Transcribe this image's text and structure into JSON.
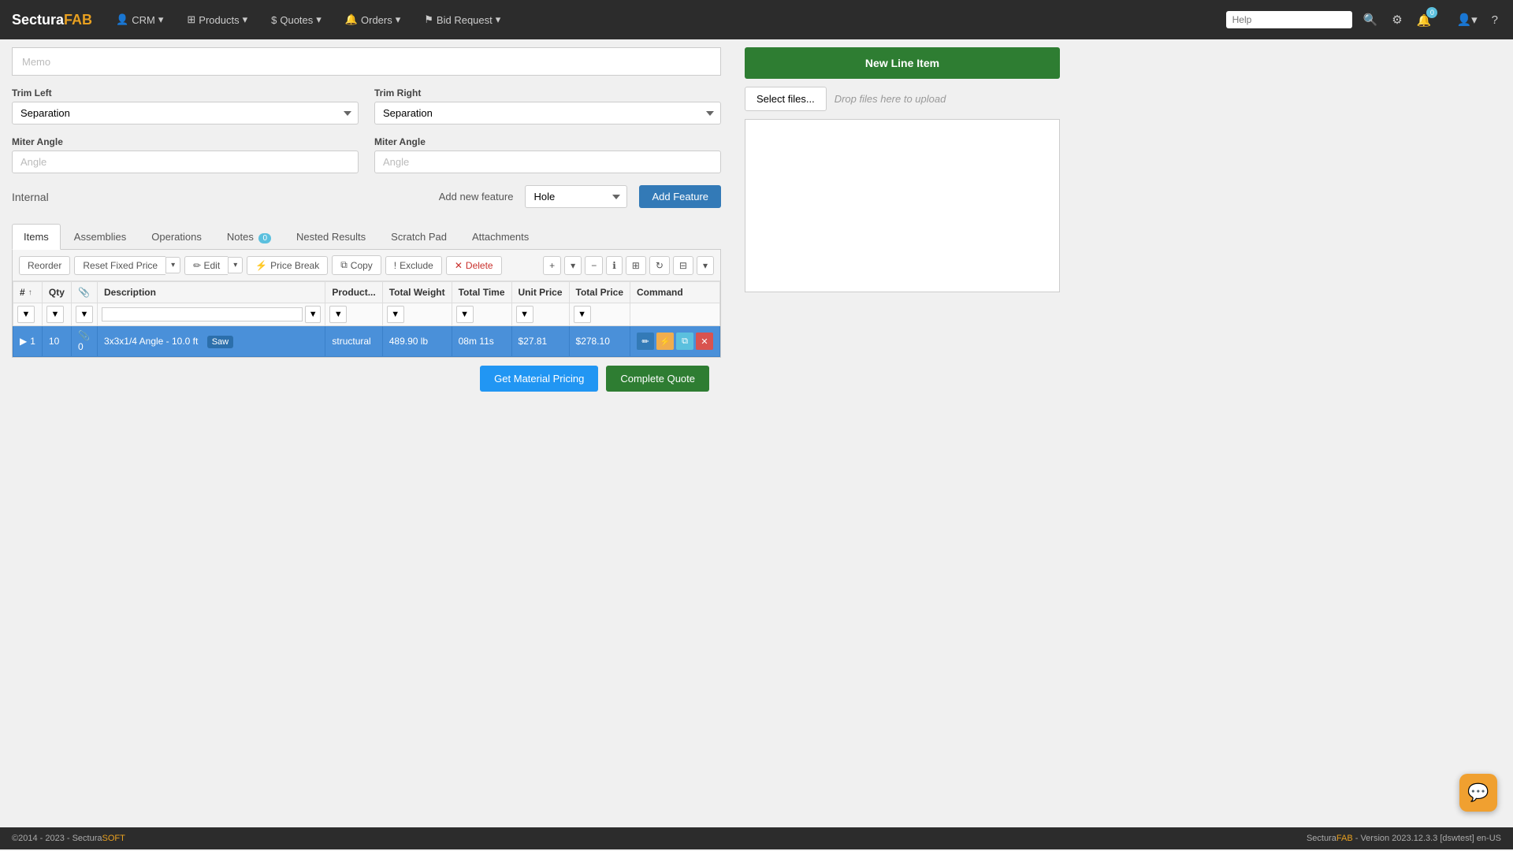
{
  "navbar": {
    "brand": "Sectura",
    "brand_highlight": "FAB",
    "nav_items": [
      {
        "label": "CRM",
        "icon": "user-icon"
      },
      {
        "label": "Products",
        "icon": "grid-icon"
      },
      {
        "label": "Quotes",
        "icon": "dollar-icon"
      },
      {
        "label": "Orders",
        "icon": "bell-icon"
      },
      {
        "label": "Bid Request",
        "icon": "flag-icon"
      }
    ],
    "search_placeholder": "Help",
    "badge_count": "0"
  },
  "header": {
    "new_line_item": "New Line Item"
  },
  "form": {
    "memo_placeholder": "Memo",
    "trim_left_label": "Trim Left",
    "trim_left_value": "Separation",
    "trim_right_label": "Trim Right",
    "trim_right_value": "Separation",
    "miter_left_label": "Miter Angle",
    "miter_left_placeholder": "Angle",
    "miter_right_label": "Miter Angle",
    "miter_right_placeholder": "Angle",
    "internal_label": "Internal",
    "add_new_feature_label": "Add new feature",
    "feature_value": "Hole",
    "add_feature_btn": "Add Feature"
  },
  "tabs": [
    {
      "label": "Items",
      "badge": null,
      "active": true
    },
    {
      "label": "Assemblies",
      "badge": null,
      "active": false
    },
    {
      "label": "Operations",
      "badge": null,
      "active": false
    },
    {
      "label": "Notes",
      "badge": "0",
      "active": false
    },
    {
      "label": "Nested Results",
      "badge": null,
      "active": false
    },
    {
      "label": "Scratch Pad",
      "badge": null,
      "active": false
    },
    {
      "label": "Attachments",
      "badge": null,
      "active": false
    }
  ],
  "toolbar": {
    "reorder": "Reorder",
    "reset_fixed_price": "Reset Fixed Price",
    "edit": "Edit",
    "price_break": "Price Break",
    "copy": "Copy",
    "exclude": "Exclude",
    "delete": "Delete"
  },
  "table": {
    "columns": [
      "#",
      "Qty",
      "",
      "Description",
      "Product...",
      "Total Weight",
      "Total Time",
      "Unit Price",
      "Total Price",
      "Command"
    ],
    "rows": [
      {
        "num": "1",
        "qty": "10",
        "attach": "0",
        "description": "3x3x1/4 Angle - 10.0 ft",
        "tag": "Saw",
        "product": "structural",
        "total_weight": "489.90 lb",
        "total_time": "08m 11s",
        "unit_price": "$27.81",
        "total_price": "$278.10",
        "selected": true
      }
    ]
  },
  "file_upload": {
    "select_files_btn": "Select files...",
    "drop_text": "Drop files here to upload"
  },
  "actions": {
    "get_material_pricing": "Get Material Pricing",
    "complete_quote": "Complete Quote"
  },
  "footer": {
    "copyright": "©2014 - 2023 - Sectura",
    "copyright_highlight": "SOFT",
    "version": "Sectura",
    "version_highlight": "FAB",
    "version_text": " - Version 2023.12.3.3 [dswtest] en-US"
  }
}
